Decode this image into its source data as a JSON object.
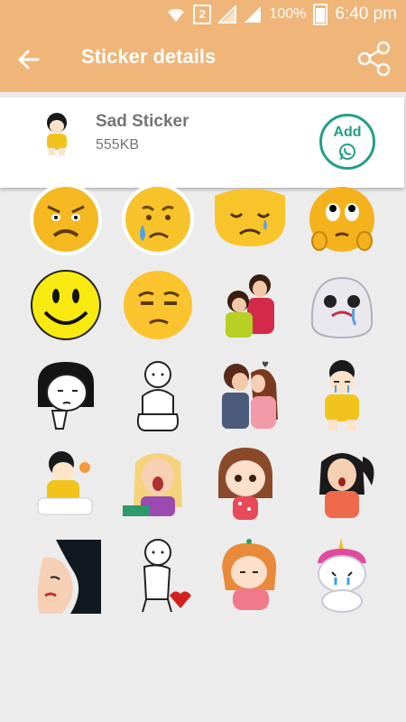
{
  "status_bar": {
    "sim_slot": "2",
    "battery": "100%",
    "time": "6:40 pm"
  },
  "toolbar": {
    "title": "Sticker details",
    "back_icon": "arrow-back-icon",
    "share_icon": "share-icon"
  },
  "pack": {
    "name": "Sad Sticker",
    "size": "555KB",
    "add_label": "Add",
    "add_icon": "whatsapp-icon"
  },
  "colors": {
    "accent": "#f0b578",
    "add_button": "#22a084",
    "background": "#ececec",
    "text_secondary": "#757575"
  },
  "stickers": [
    "angry-face-sticker",
    "crying-face-sticker",
    "tear-face-sticker",
    "pleading-face-sticker",
    "smiley-face-sticker",
    "unamused-face-sticker",
    "hugging-couple-sticker",
    "crying-ghost-sticker",
    "sad-girl-sticker",
    "sad-stickman-sticker",
    "kissing-couple-sticker",
    "crying-girl-sticker",
    "tired-girl-sticker",
    "shouting-girl-sticker",
    "sorry-girl-sticker",
    "screaming-girl-sticker",
    "sad-woman-sticker",
    "broken-heart-stickman-sticker",
    "sulking-girl-sticker",
    "crying-unicorn-sticker"
  ]
}
